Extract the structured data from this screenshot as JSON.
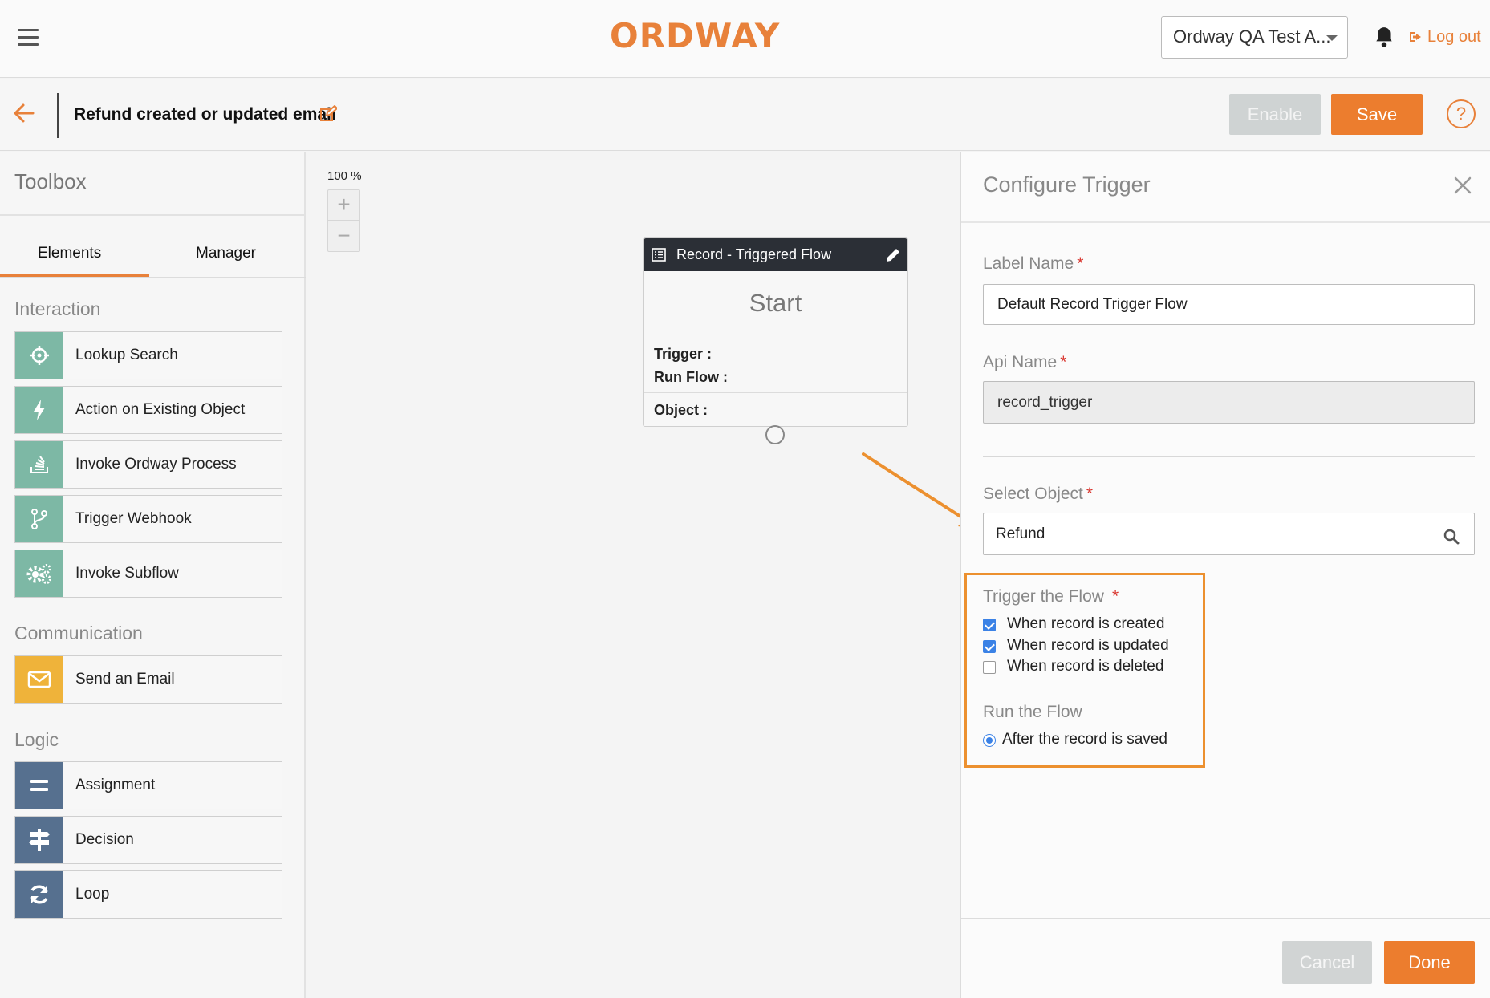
{
  "header": {
    "logo_text": "ORDWAY",
    "account_select": "Ordway QA Test A...",
    "logout_label": "Log out"
  },
  "subbar": {
    "flow_title": "Refund created or updated email",
    "enable_label": "Enable",
    "save_label": "Save",
    "help_label": "?"
  },
  "toolbox": {
    "title": "Toolbox",
    "tabs": [
      {
        "label": "Elements",
        "active": true
      },
      {
        "label": "Manager",
        "active": false
      }
    ],
    "sections": [
      {
        "heading": "Interaction",
        "items": [
          {
            "label": "Lookup Search",
            "icon": "crosshair-icon"
          },
          {
            "label": "Action on Existing Object",
            "icon": "bolt-icon"
          },
          {
            "label": "Invoke Ordway Process",
            "icon": "stack-icon"
          },
          {
            "label": "Trigger Webhook",
            "icon": "branch-icon"
          },
          {
            "label": "Invoke Subflow",
            "icon": "gears-icon"
          }
        ]
      },
      {
        "heading": "Communication",
        "items": [
          {
            "label": "Send an Email",
            "icon": "envelope-icon"
          }
        ]
      },
      {
        "heading": "Logic",
        "items": [
          {
            "label": "Assignment",
            "icon": "equals-icon"
          },
          {
            "label": "Decision",
            "icon": "signpost-icon"
          },
          {
            "label": "Loop",
            "icon": "refresh-icon"
          }
        ]
      }
    ]
  },
  "canvas": {
    "zoom_label": "100 %",
    "zoom_in": "+",
    "zoom_out": "−",
    "node": {
      "header": "Record - Triggered Flow",
      "start": "Start",
      "trigger_label": "Trigger :",
      "run_flow_label": "Run Flow :",
      "object_label": "Object :"
    }
  },
  "panel": {
    "title": "Configure Trigger",
    "label_name": {
      "label": "Label Name",
      "value": "Default Record Trigger Flow"
    },
    "api_name": {
      "label": "Api Name",
      "value": "record_trigger"
    },
    "select_object": {
      "label": "Select Object",
      "value": "Refund"
    },
    "required_mark": "*",
    "trigger_the_flow": {
      "label": "Trigger the Flow",
      "options": [
        {
          "label": "When record is created",
          "checked": true
        },
        {
          "label": "When record is updated",
          "checked": true
        },
        {
          "label": "When record is deleted",
          "checked": false
        }
      ]
    },
    "run_the_flow": {
      "label": "Run the Flow",
      "options": [
        {
          "label": "After the record is saved",
          "selected": true
        }
      ]
    },
    "cancel_label": "Cancel",
    "done_label": "Done"
  },
  "colors": {
    "accent": "#ec7d2e",
    "dark_header": "#2b2f36",
    "green_icon": "#7db8a5",
    "yellow_icon": "#efb33a",
    "slate_icon": "#56708f",
    "checkbox_blue": "#3b82e6"
  }
}
